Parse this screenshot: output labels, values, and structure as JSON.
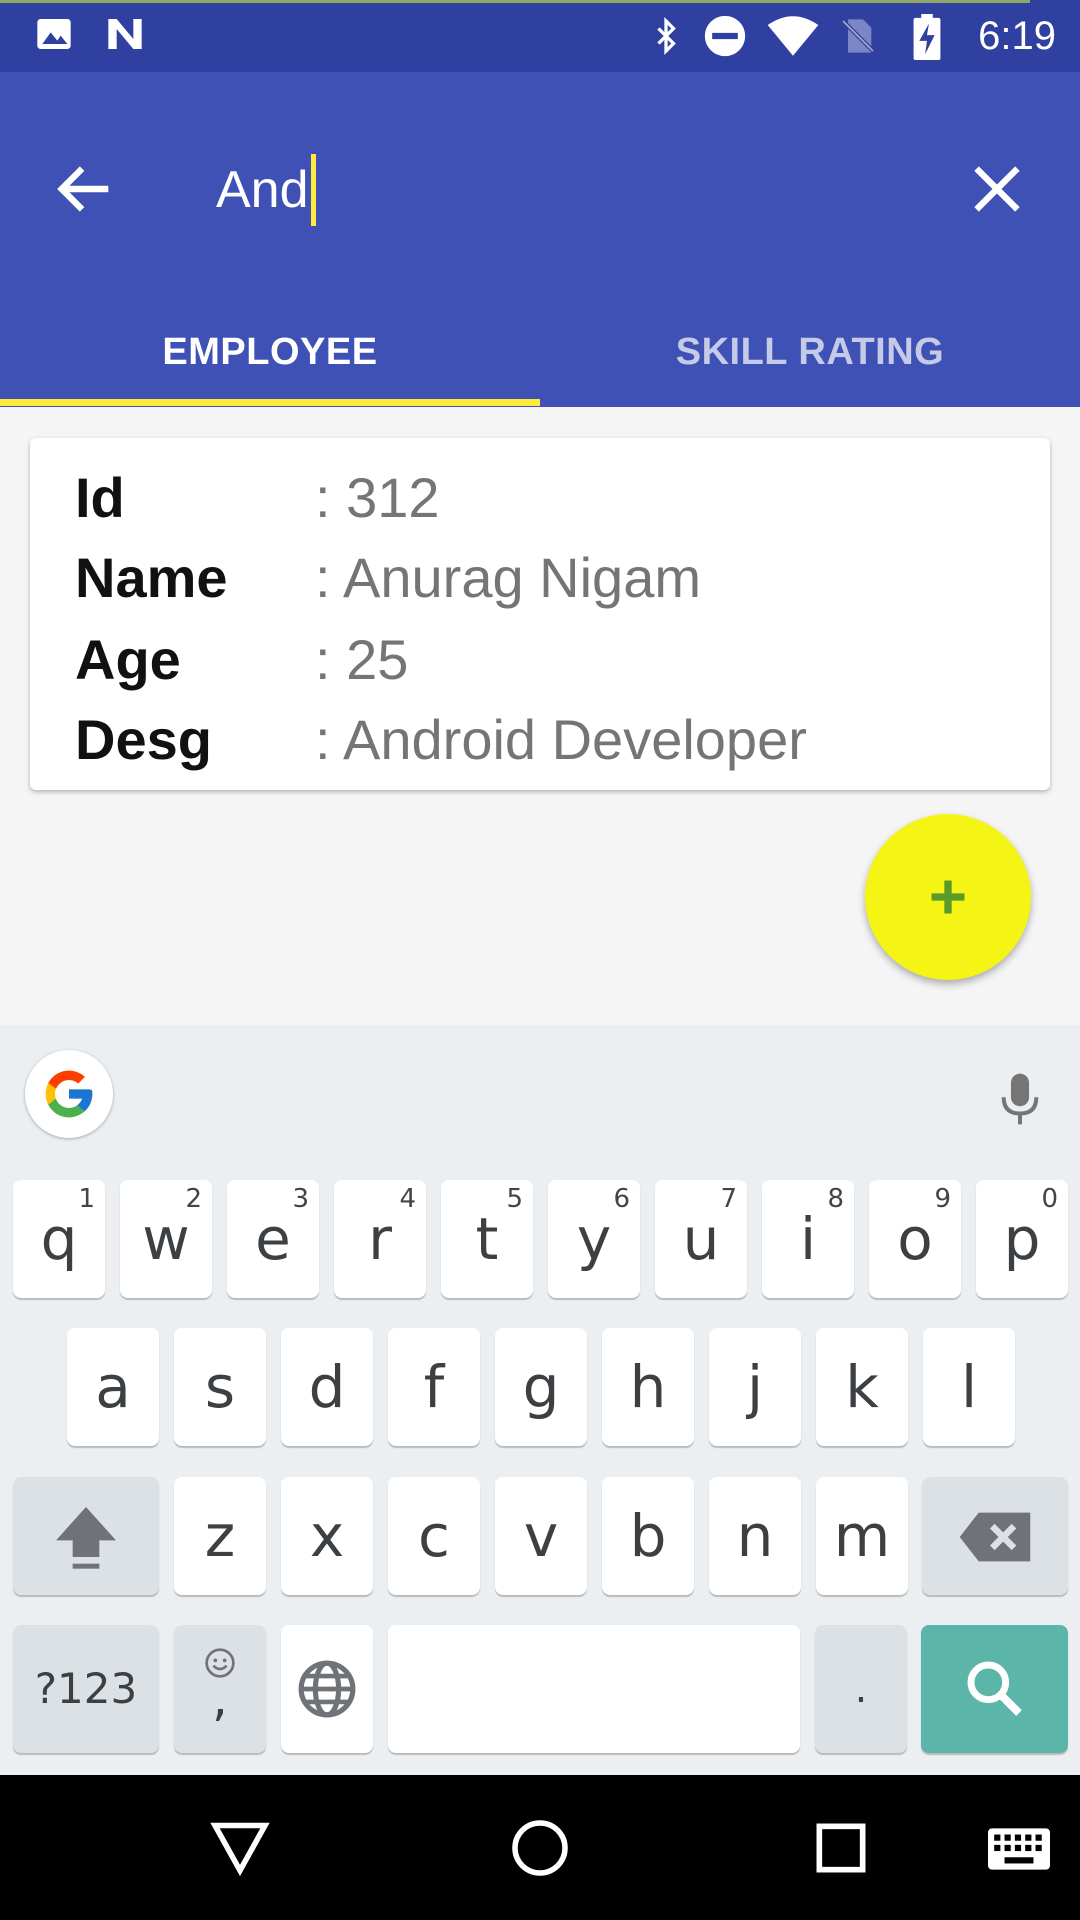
{
  "status_bar": {
    "time": "6:19",
    "icons": [
      "image-icon",
      "n-logo-icon",
      "bluetooth-icon",
      "do-not-disturb-icon",
      "wifi-icon",
      "no-sim-icon",
      "battery-charging-icon"
    ]
  },
  "search": {
    "query": "And"
  },
  "tabs": [
    {
      "label": "EMPLOYEE",
      "active": true
    },
    {
      "label": "SKILL RATING",
      "active": false
    }
  ],
  "employee": {
    "rows": [
      {
        "label": "Id",
        "value": ": 312"
      },
      {
        "label": "Name",
        "value": ": Anurag Nigam"
      },
      {
        "label": "Age",
        "value": ": 25"
      },
      {
        "label": "Desg",
        "value": ": Android Developer"
      }
    ]
  },
  "fab": {
    "icon": "plus-icon",
    "color": "#f5f515"
  },
  "colors": {
    "app_bar": "#3f51b5",
    "status_bar": "#3040a0",
    "accent": "#ffeb3b",
    "search_key": "#5bb5a9"
  },
  "keyboard": {
    "row1": [
      {
        "ch": "q",
        "hint": "1"
      },
      {
        "ch": "w",
        "hint": "2"
      },
      {
        "ch": "e",
        "hint": "3"
      },
      {
        "ch": "r",
        "hint": "4"
      },
      {
        "ch": "t",
        "hint": "5"
      },
      {
        "ch": "y",
        "hint": "6"
      },
      {
        "ch": "u",
        "hint": "7"
      },
      {
        "ch": "i",
        "hint": "8"
      },
      {
        "ch": "o",
        "hint": "9"
      },
      {
        "ch": "p",
        "hint": "0"
      }
    ],
    "row2": [
      "a",
      "s",
      "d",
      "f",
      "g",
      "h",
      "j",
      "k",
      "l"
    ],
    "row3": [
      "z",
      "x",
      "c",
      "v",
      "b",
      "n",
      "m"
    ],
    "symbols_label": "?123",
    "emoji_comma": ",",
    "period": "."
  }
}
